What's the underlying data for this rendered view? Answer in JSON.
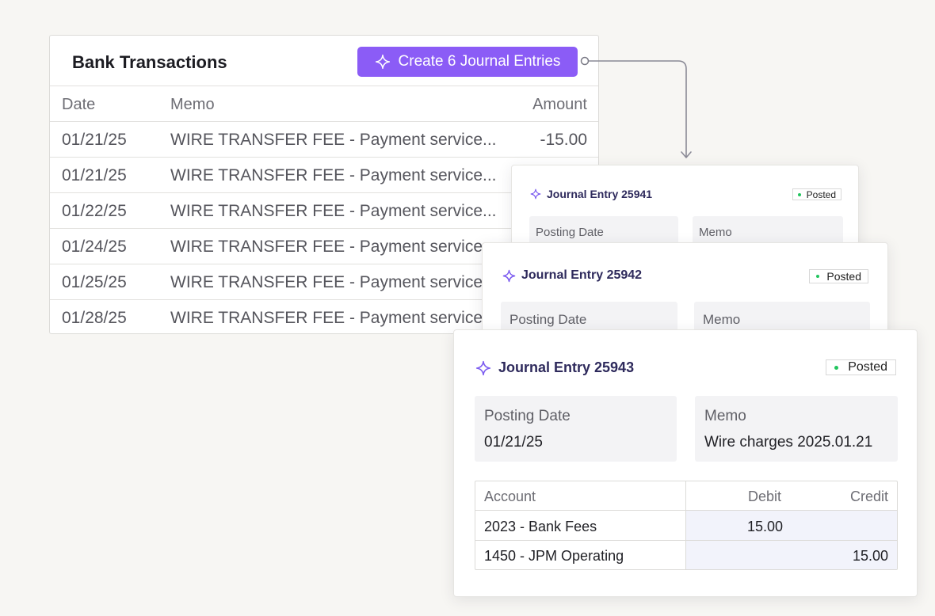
{
  "bank": {
    "title": "Bank Transactions",
    "create_button_label": "Create 6 Journal Entries",
    "columns": {
      "date": "Date",
      "memo": "Memo",
      "amount": "Amount"
    },
    "rows": [
      {
        "date": "01/21/25",
        "memo": "WIRE TRANSFER FEE - Payment service...",
        "amount": "-15.00"
      },
      {
        "date": "01/21/25",
        "memo": "WIRE TRANSFER FEE - Payment service...",
        "amount": ""
      },
      {
        "date": "01/22/25",
        "memo": "WIRE TRANSFER FEE - Payment service...",
        "amount": ""
      },
      {
        "date": "01/24/25",
        "memo": "WIRE TRANSFER FEE - Payment service.",
        "amount": ""
      },
      {
        "date": "01/25/25",
        "memo": "WIRE TRANSFER FEE - Payment service.",
        "amount": ""
      },
      {
        "date": "01/28/25",
        "memo": "WIRE TRANSFER FEE - Payment service.",
        "amount": ""
      }
    ]
  },
  "journal_entries": [
    {
      "title": "Journal Entry 25941",
      "status": "Posted",
      "posting_date_label": "Posting Date",
      "memo_label": "Memo"
    },
    {
      "title": "Journal Entry 25942",
      "status": "Posted",
      "posting_date_label": "Posting Date",
      "memo_label": "Memo"
    },
    {
      "title": "Journal Entry 25943",
      "status": "Posted",
      "posting_date_label": "Posting Date",
      "posting_date": "01/21/25",
      "memo_label": "Memo",
      "memo": "Wire charges 2025.01.21",
      "table": {
        "headers": {
          "account": "Account",
          "debit": "Debit",
          "credit": "Credit"
        },
        "rows": [
          {
            "account": "2023 - Bank Fees",
            "debit": "15.00",
            "credit": ""
          },
          {
            "account": "1450 - JPM Operating",
            "debit": "",
            "credit": "15.00"
          }
        ]
      }
    }
  ],
  "colors": {
    "accent": "#8b5cf6",
    "title_text": "#2e2a5c",
    "status_dot": "#22c55e",
    "background": "#f7f6f3"
  },
  "icons": {
    "create_button": "sparkle-icon",
    "journal_title": "sparkle-icon",
    "status": "dot-icon"
  }
}
